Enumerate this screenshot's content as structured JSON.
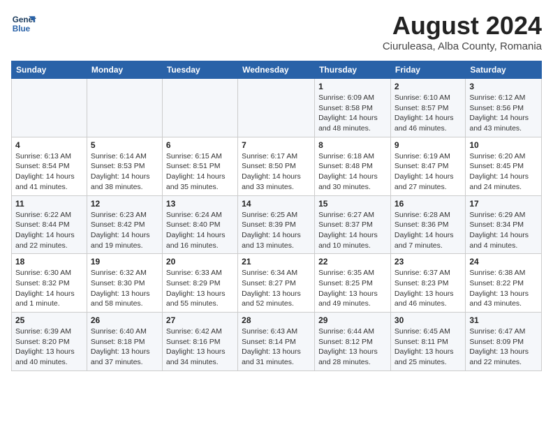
{
  "header": {
    "logo_line1": "General",
    "logo_line2": "Blue",
    "main_title": "August 2024",
    "subtitle": "Ciuruleasa, Alba County, Romania"
  },
  "days_of_week": [
    "Sunday",
    "Monday",
    "Tuesday",
    "Wednesday",
    "Thursday",
    "Friday",
    "Saturday"
  ],
  "weeks": [
    [
      {
        "day": "",
        "info": ""
      },
      {
        "day": "",
        "info": ""
      },
      {
        "day": "",
        "info": ""
      },
      {
        "day": "",
        "info": ""
      },
      {
        "day": "1",
        "info": "Sunrise: 6:09 AM\nSunset: 8:58 PM\nDaylight: 14 hours\nand 48 minutes."
      },
      {
        "day": "2",
        "info": "Sunrise: 6:10 AM\nSunset: 8:57 PM\nDaylight: 14 hours\nand 46 minutes."
      },
      {
        "day": "3",
        "info": "Sunrise: 6:12 AM\nSunset: 8:56 PM\nDaylight: 14 hours\nand 43 minutes."
      }
    ],
    [
      {
        "day": "4",
        "info": "Sunrise: 6:13 AM\nSunset: 8:54 PM\nDaylight: 14 hours\nand 41 minutes."
      },
      {
        "day": "5",
        "info": "Sunrise: 6:14 AM\nSunset: 8:53 PM\nDaylight: 14 hours\nand 38 minutes."
      },
      {
        "day": "6",
        "info": "Sunrise: 6:15 AM\nSunset: 8:51 PM\nDaylight: 14 hours\nand 35 minutes."
      },
      {
        "day": "7",
        "info": "Sunrise: 6:17 AM\nSunset: 8:50 PM\nDaylight: 14 hours\nand 33 minutes."
      },
      {
        "day": "8",
        "info": "Sunrise: 6:18 AM\nSunset: 8:48 PM\nDaylight: 14 hours\nand 30 minutes."
      },
      {
        "day": "9",
        "info": "Sunrise: 6:19 AM\nSunset: 8:47 PM\nDaylight: 14 hours\nand 27 minutes."
      },
      {
        "day": "10",
        "info": "Sunrise: 6:20 AM\nSunset: 8:45 PM\nDaylight: 14 hours\nand 24 minutes."
      }
    ],
    [
      {
        "day": "11",
        "info": "Sunrise: 6:22 AM\nSunset: 8:44 PM\nDaylight: 14 hours\nand 22 minutes."
      },
      {
        "day": "12",
        "info": "Sunrise: 6:23 AM\nSunset: 8:42 PM\nDaylight: 14 hours\nand 19 minutes."
      },
      {
        "day": "13",
        "info": "Sunrise: 6:24 AM\nSunset: 8:40 PM\nDaylight: 14 hours\nand 16 minutes."
      },
      {
        "day": "14",
        "info": "Sunrise: 6:25 AM\nSunset: 8:39 PM\nDaylight: 14 hours\nand 13 minutes."
      },
      {
        "day": "15",
        "info": "Sunrise: 6:27 AM\nSunset: 8:37 PM\nDaylight: 14 hours\nand 10 minutes."
      },
      {
        "day": "16",
        "info": "Sunrise: 6:28 AM\nSunset: 8:36 PM\nDaylight: 14 hours\nand 7 minutes."
      },
      {
        "day": "17",
        "info": "Sunrise: 6:29 AM\nSunset: 8:34 PM\nDaylight: 14 hours\nand 4 minutes."
      }
    ],
    [
      {
        "day": "18",
        "info": "Sunrise: 6:30 AM\nSunset: 8:32 PM\nDaylight: 14 hours\nand 1 minute."
      },
      {
        "day": "19",
        "info": "Sunrise: 6:32 AM\nSunset: 8:30 PM\nDaylight: 13 hours\nand 58 minutes."
      },
      {
        "day": "20",
        "info": "Sunrise: 6:33 AM\nSunset: 8:29 PM\nDaylight: 13 hours\nand 55 minutes."
      },
      {
        "day": "21",
        "info": "Sunrise: 6:34 AM\nSunset: 8:27 PM\nDaylight: 13 hours\nand 52 minutes."
      },
      {
        "day": "22",
        "info": "Sunrise: 6:35 AM\nSunset: 8:25 PM\nDaylight: 13 hours\nand 49 minutes."
      },
      {
        "day": "23",
        "info": "Sunrise: 6:37 AM\nSunset: 8:23 PM\nDaylight: 13 hours\nand 46 minutes."
      },
      {
        "day": "24",
        "info": "Sunrise: 6:38 AM\nSunset: 8:22 PM\nDaylight: 13 hours\nand 43 minutes."
      }
    ],
    [
      {
        "day": "25",
        "info": "Sunrise: 6:39 AM\nSunset: 8:20 PM\nDaylight: 13 hours\nand 40 minutes."
      },
      {
        "day": "26",
        "info": "Sunrise: 6:40 AM\nSunset: 8:18 PM\nDaylight: 13 hours\nand 37 minutes."
      },
      {
        "day": "27",
        "info": "Sunrise: 6:42 AM\nSunset: 8:16 PM\nDaylight: 13 hours\nand 34 minutes."
      },
      {
        "day": "28",
        "info": "Sunrise: 6:43 AM\nSunset: 8:14 PM\nDaylight: 13 hours\nand 31 minutes."
      },
      {
        "day": "29",
        "info": "Sunrise: 6:44 AM\nSunset: 8:12 PM\nDaylight: 13 hours\nand 28 minutes."
      },
      {
        "day": "30",
        "info": "Sunrise: 6:45 AM\nSunset: 8:11 PM\nDaylight: 13 hours\nand 25 minutes."
      },
      {
        "day": "31",
        "info": "Sunrise: 6:47 AM\nSunset: 8:09 PM\nDaylight: 13 hours\nand 22 minutes."
      }
    ]
  ]
}
